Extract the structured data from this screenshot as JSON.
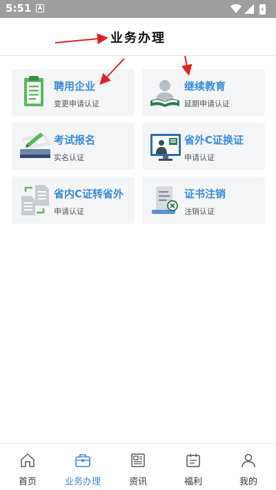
{
  "status": {
    "time": "5:51",
    "notification_letter": "A"
  },
  "header": {
    "title": "业务办理"
  },
  "services": [
    {
      "title": "聘用企业",
      "subtitle": "变更申请认证",
      "icon": "clipboard-icon"
    },
    {
      "title": "继续教育",
      "subtitle": "延期申请认证",
      "icon": "reader-book-icon"
    },
    {
      "title": "考试报名",
      "subtitle": "实名认证",
      "icon": "book-pen-icon"
    },
    {
      "title": "省外C证换证",
      "subtitle": "申请认证",
      "icon": "monitor-presenter-icon"
    },
    {
      "title": "省内C证转省外",
      "subtitle": "申请认证",
      "icon": "document-transfer-icon"
    },
    {
      "title": "证书注销",
      "subtitle": "注销认证",
      "icon": "certificate-cancel-icon"
    }
  ],
  "tabs": [
    {
      "label": "首页",
      "icon": "home-icon",
      "active": false
    },
    {
      "label": "业务办理",
      "icon": "briefcase-icon",
      "active": true
    },
    {
      "label": "资讯",
      "icon": "newspaper-icon",
      "active": false
    },
    {
      "label": "福利",
      "icon": "calendar-icon",
      "active": false
    },
    {
      "label": "我的",
      "icon": "user-icon",
      "active": false
    }
  ],
  "colors": {
    "accent": "#3b8ad8",
    "card_bg": "#f4f5f7",
    "status_bar": "#9e9e9e",
    "annotation_arrow": "#e02020"
  }
}
